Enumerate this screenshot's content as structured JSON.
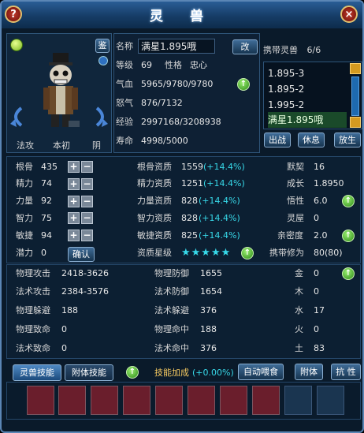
{
  "window": {
    "title": "灵 兽"
  },
  "pet": {
    "name_label": "名称",
    "name_value": "满星1.895哦",
    "rename_button": "改",
    "level_label": "等级",
    "level_value": "69",
    "personality_label": "性格",
    "personality_value": "忠心",
    "hp_label": "气血",
    "hp_value": "5965/9780/9780",
    "rage_label": "怒气",
    "rage_value": "876/7132",
    "exp_label": "经验",
    "exp_value": "2997168/3208938",
    "life_label": "寿命",
    "life_value": "4998/5000",
    "appraise_button": "鉴",
    "tag_left": "法攻",
    "tag_mid": "本初",
    "tag_right": "阴"
  },
  "carry": {
    "label": "携带灵兽",
    "count": "6/6",
    "items": [
      "1.895-3",
      "1.895-2",
      "1.995-2",
      "满星1.895哦"
    ],
    "deploy_button": "出战",
    "rest_button": "休息",
    "release_button": "放生"
  },
  "attrs": [
    {
      "label": "根骨",
      "value": "435"
    },
    {
      "label": "精力",
      "value": "74"
    },
    {
      "label": "力量",
      "value": "92"
    },
    {
      "label": "智力",
      "value": "75"
    },
    {
      "label": "敏捷",
      "value": "94"
    }
  ],
  "potential": {
    "label": "潜力",
    "value": "0",
    "confirm_button": "确认"
  },
  "aptitudes": [
    {
      "label": "根骨资质",
      "value": "1559",
      "bonus": "(+14.4%)"
    },
    {
      "label": "精力资质",
      "value": "1251",
      "bonus": "(+14.4%)"
    },
    {
      "label": "力量资质",
      "value": "828",
      "bonus": "(+14.4%)"
    },
    {
      "label": "智力资质",
      "value": "828",
      "bonus": "(+14.4%)"
    },
    {
      "label": "敏捷资质",
      "value": "825",
      "bonus": "(+14.4%)"
    }
  ],
  "star_rating": {
    "label": "资质星级",
    "stars": "★★★★★"
  },
  "right_stats": [
    {
      "label": "默契",
      "value": "16"
    },
    {
      "label": "成长",
      "value": "1.8950"
    },
    {
      "label": "悟性",
      "value": "6.0"
    },
    {
      "label": "灵屋",
      "value": "0"
    },
    {
      "label": "亲密度",
      "value": "2.0"
    }
  ],
  "cultivation": {
    "label": "携带修为",
    "value": "80(80)"
  },
  "combat_left": [
    {
      "label": "物理攻击",
      "value": "2418-3626"
    },
    {
      "label": "法术攻击",
      "value": "2384-3576"
    },
    {
      "label": "物理躲避",
      "value": "188"
    },
    {
      "label": "物理致命",
      "value": "0"
    },
    {
      "label": "法术致命",
      "value": "0"
    }
  ],
  "combat_mid": [
    {
      "label": "物理防御",
      "value": "1655"
    },
    {
      "label": "法术防御",
      "value": "1654"
    },
    {
      "label": "法术躲避",
      "value": "376"
    },
    {
      "label": "物理命中",
      "value": "188"
    },
    {
      "label": "法术命中",
      "value": "376"
    }
  ],
  "elements": [
    {
      "label": "金",
      "value": "0"
    },
    {
      "label": "木",
      "value": "0"
    },
    {
      "label": "水",
      "value": "17"
    },
    {
      "label": "火",
      "value": "0"
    },
    {
      "label": "土",
      "value": "83"
    }
  ],
  "bottom": {
    "tab_pet_skills": "灵兽技能",
    "tab_attached_skills": "附体技能",
    "skill_bonus_label": "技能加成",
    "skill_bonus_value": "(+0.00%)",
    "auto_feed_button": "自动喂食",
    "attach_button": "附体",
    "resist_button": "抗 性"
  },
  "plus_symbol": "+",
  "minus_symbol": "−",
  "up_arrow": "↑"
}
